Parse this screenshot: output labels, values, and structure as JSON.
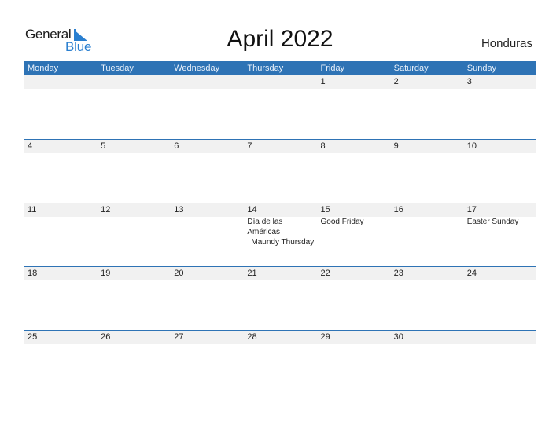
{
  "logo": {
    "general": "General",
    "blue": "Blue"
  },
  "title": "April 2022",
  "country": "Honduras",
  "colors": {
    "header": "#2e73b5",
    "band": "#f1f1f1",
    "brand_blue": "#2a7fd0"
  },
  "weekdays": [
    "Monday",
    "Tuesday",
    "Wednesday",
    "Thursday",
    "Friday",
    "Saturday",
    "Sunday"
  ],
  "weeks": [
    {
      "days": [
        {
          "d": "",
          "e": []
        },
        {
          "d": "",
          "e": []
        },
        {
          "d": "",
          "e": []
        },
        {
          "d": "",
          "e": []
        },
        {
          "d": "1",
          "e": []
        },
        {
          "d": "2",
          "e": []
        },
        {
          "d": "3",
          "e": []
        }
      ]
    },
    {
      "days": [
        {
          "d": "4",
          "e": []
        },
        {
          "d": "5",
          "e": []
        },
        {
          "d": "6",
          "e": []
        },
        {
          "d": "7",
          "e": []
        },
        {
          "d": "8",
          "e": []
        },
        {
          "d": "9",
          "e": []
        },
        {
          "d": "10",
          "e": []
        }
      ]
    },
    {
      "days": [
        {
          "d": "11",
          "e": []
        },
        {
          "d": "12",
          "e": []
        },
        {
          "d": "13",
          "e": []
        },
        {
          "d": "14",
          "e": [
            "Día de las Américas",
            "Maundy Thursday"
          ]
        },
        {
          "d": "15",
          "e": [
            "Good Friday"
          ]
        },
        {
          "d": "16",
          "e": []
        },
        {
          "d": "17",
          "e": [
            "Easter Sunday"
          ]
        }
      ]
    },
    {
      "days": [
        {
          "d": "18",
          "e": []
        },
        {
          "d": "19",
          "e": []
        },
        {
          "d": "20",
          "e": []
        },
        {
          "d": "21",
          "e": []
        },
        {
          "d": "22",
          "e": []
        },
        {
          "d": "23",
          "e": []
        },
        {
          "d": "24",
          "e": []
        }
      ]
    },
    {
      "days": [
        {
          "d": "25",
          "e": []
        },
        {
          "d": "26",
          "e": []
        },
        {
          "d": "27",
          "e": []
        },
        {
          "d": "28",
          "e": []
        },
        {
          "d": "29",
          "e": []
        },
        {
          "d": "30",
          "e": []
        },
        {
          "d": "",
          "e": []
        }
      ]
    }
  ]
}
